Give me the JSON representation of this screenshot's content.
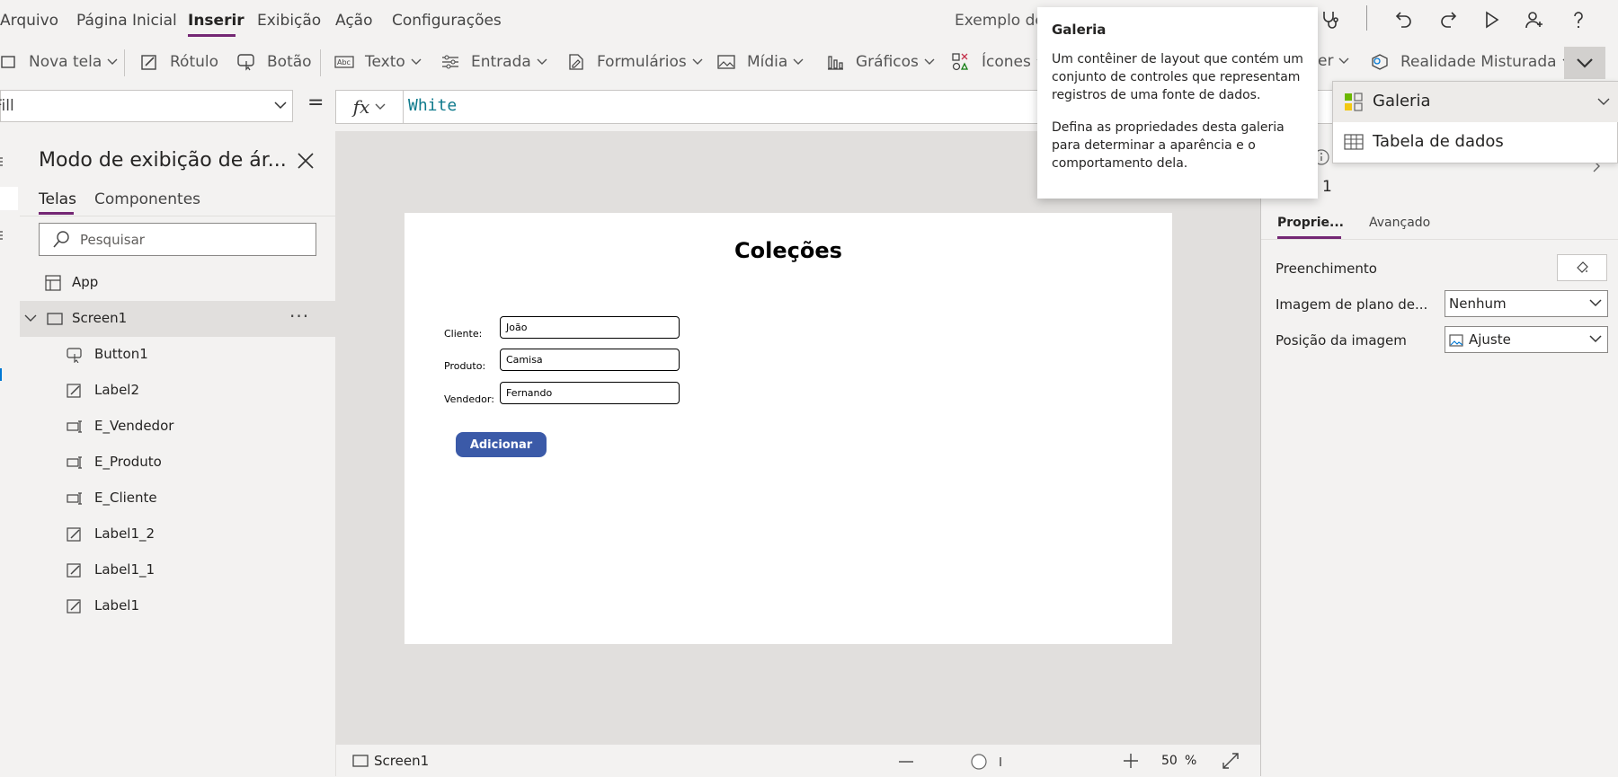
{
  "menubar": {
    "items": [
      "Arquivo",
      "Página Inicial",
      "Inserir",
      "Exibição",
      "Ação",
      "Configurações"
    ],
    "active": "Inserir",
    "app_title": "Exemplo de"
  },
  "ribbon": {
    "items": [
      {
        "label": "Nova tela",
        "icon": "new-screen-icon"
      },
      {
        "label": "Rótulo",
        "icon": "label-icon"
      },
      {
        "label": "Botão",
        "icon": "button-icon"
      },
      {
        "label": "Texto",
        "icon": "text-icon"
      },
      {
        "label": "Entrada",
        "icon": "input-icon"
      },
      {
        "label": "Formulários",
        "icon": "forms-icon"
      },
      {
        "label": "Mídia",
        "icon": "media-icon"
      },
      {
        "label": "Gráficos",
        "icon": "charts-icon"
      },
      {
        "label": "Ícones",
        "icon": "icons-icon"
      },
      {
        "label": "er",
        "icon": ""
      },
      {
        "label": "Realidade Misturada",
        "icon": "mixed-reality-icon"
      }
    ]
  },
  "formula": {
    "property": "Fill",
    "fx_label": "fx",
    "equals": "=",
    "value": "White"
  },
  "tree": {
    "title": "Modo de exibição de ár...",
    "tabs": [
      "Telas",
      "Componentes"
    ],
    "active_tab": "Telas",
    "search_placeholder": "Pesquisar",
    "app_label": "App",
    "screen_label": "Screen1",
    "more": "···",
    "children": [
      {
        "label": "Button1",
        "icon": "button-control-icon"
      },
      {
        "label": "Label2",
        "icon": "label-control-icon"
      },
      {
        "label": "E_Vendedor",
        "icon": "textinput-control-icon"
      },
      {
        "label": "E_Produto",
        "icon": "textinput-control-icon"
      },
      {
        "label": "E_Cliente",
        "icon": "textinput-control-icon"
      },
      {
        "label": "Label1_2",
        "icon": "label-control-icon"
      },
      {
        "label": "Label1_1",
        "icon": "label-control-icon"
      },
      {
        "label": "Label1",
        "icon": "label-control-icon"
      }
    ]
  },
  "canvas": {
    "title": "Coleções",
    "fields": [
      {
        "label": "Cliente:",
        "value": "João"
      },
      {
        "label": "Produto:",
        "value": "Camisa"
      },
      {
        "label": "Vendedor:",
        "value": "Fernando"
      }
    ],
    "button_label": "Adicionar",
    "button_color": "#3b5aa8"
  },
  "statusbar": {
    "screen_label": "Screen1",
    "zoom_value": "50",
    "zoom_unit": "%"
  },
  "properties": {
    "header_fragment": "1",
    "tabs": [
      "Proprie...",
      "Avançado"
    ],
    "active_tab": "Proprie...",
    "rows": [
      {
        "label": "Preenchimento",
        "value": ""
      },
      {
        "label": "Imagem de plano de...",
        "value": "Nenhum"
      },
      {
        "label": "Posição da imagem",
        "value": "Ajuste"
      }
    ]
  },
  "dropdown_menu": {
    "items": [
      {
        "label": "Galeria",
        "icon": "gallery-icon"
      },
      {
        "label": "Tabela de dados",
        "icon": "data-table-icon"
      }
    ]
  },
  "tooltip": {
    "title": "Galeria",
    "paragraph1": "Um contêiner de layout que contém um conjunto de controles que representam registros de uma fonte de dados.",
    "paragraph2": "Defina as propriedades desta galeria para determinar a aparência e o comportamento dela."
  },
  "colors": {
    "accent": "#742774",
    "formula_text": "#0e7a8c",
    "canvas_bg": "#e1dfdd"
  }
}
